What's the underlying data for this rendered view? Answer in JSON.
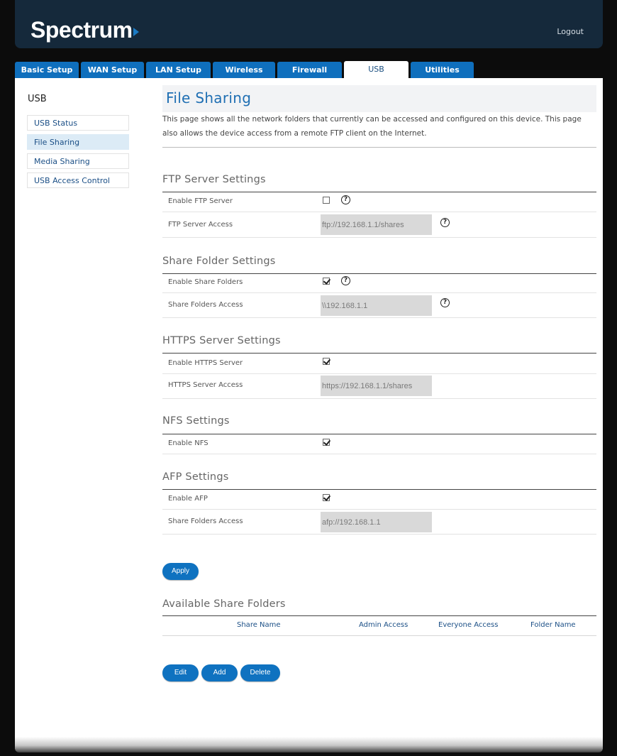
{
  "header": {
    "brand": "Spectrum",
    "logout": "Logout"
  },
  "tabs": [
    {
      "label": "Basic Setup"
    },
    {
      "label": "WAN Setup"
    },
    {
      "label": "LAN Setup"
    },
    {
      "label": "Wireless"
    },
    {
      "label": "Firewall"
    },
    {
      "label": "USB"
    },
    {
      "label": "Utilities"
    }
  ],
  "active_tab": "USB",
  "sidebar": {
    "title": "USB",
    "items": [
      {
        "label": "USB Status"
      },
      {
        "label": "File Sharing"
      },
      {
        "label": "Media Sharing"
      },
      {
        "label": "USB Access Control"
      }
    ],
    "active": "File Sharing"
  },
  "page": {
    "title": "File Sharing",
    "description": "This page shows all the network folders that currently can be accessed and configured on this device. This page also allows the device access from a remote FTP client on the Internet."
  },
  "ftp": {
    "title": "FTP Server Settings",
    "enable_label": "Enable FTP Server",
    "enabled": false,
    "access_label": "FTP Server Access",
    "access_value": "ftp://192.168.1.1/shares"
  },
  "share": {
    "title": "Share Folder Settings",
    "enable_label": "Enable Share Folders",
    "enabled": true,
    "access_label": "Share Folders Access",
    "access_value": "\\\\192.168.1.1"
  },
  "https": {
    "title": "HTTPS Server Settings",
    "enable_label": "Enable HTTPS Server",
    "enabled": true,
    "access_label": "HTTPS Server Access",
    "access_value": "https://192.168.1.1/shares"
  },
  "nfs": {
    "title": "NFS Settings",
    "enable_label": "Enable NFS",
    "enabled": true
  },
  "afp": {
    "title": "AFP Settings",
    "enable_label": "Enable AFP",
    "enabled": true,
    "access_label": "Share Folders Access",
    "access_value": "afp://192.168.1.1"
  },
  "buttons": {
    "apply": "Apply",
    "edit": "Edit",
    "add": "Add",
    "delete": "Delete"
  },
  "help_glyph": "?",
  "shares": {
    "title": "Available Share Folders",
    "columns": [
      "Share Name",
      "Admin Access",
      "Everyone Access",
      "Folder Name"
    ],
    "rows": []
  },
  "colors": {
    "accent": "#0f72c0",
    "header_bg": "#15293b",
    "title": "#1f6fb3"
  }
}
